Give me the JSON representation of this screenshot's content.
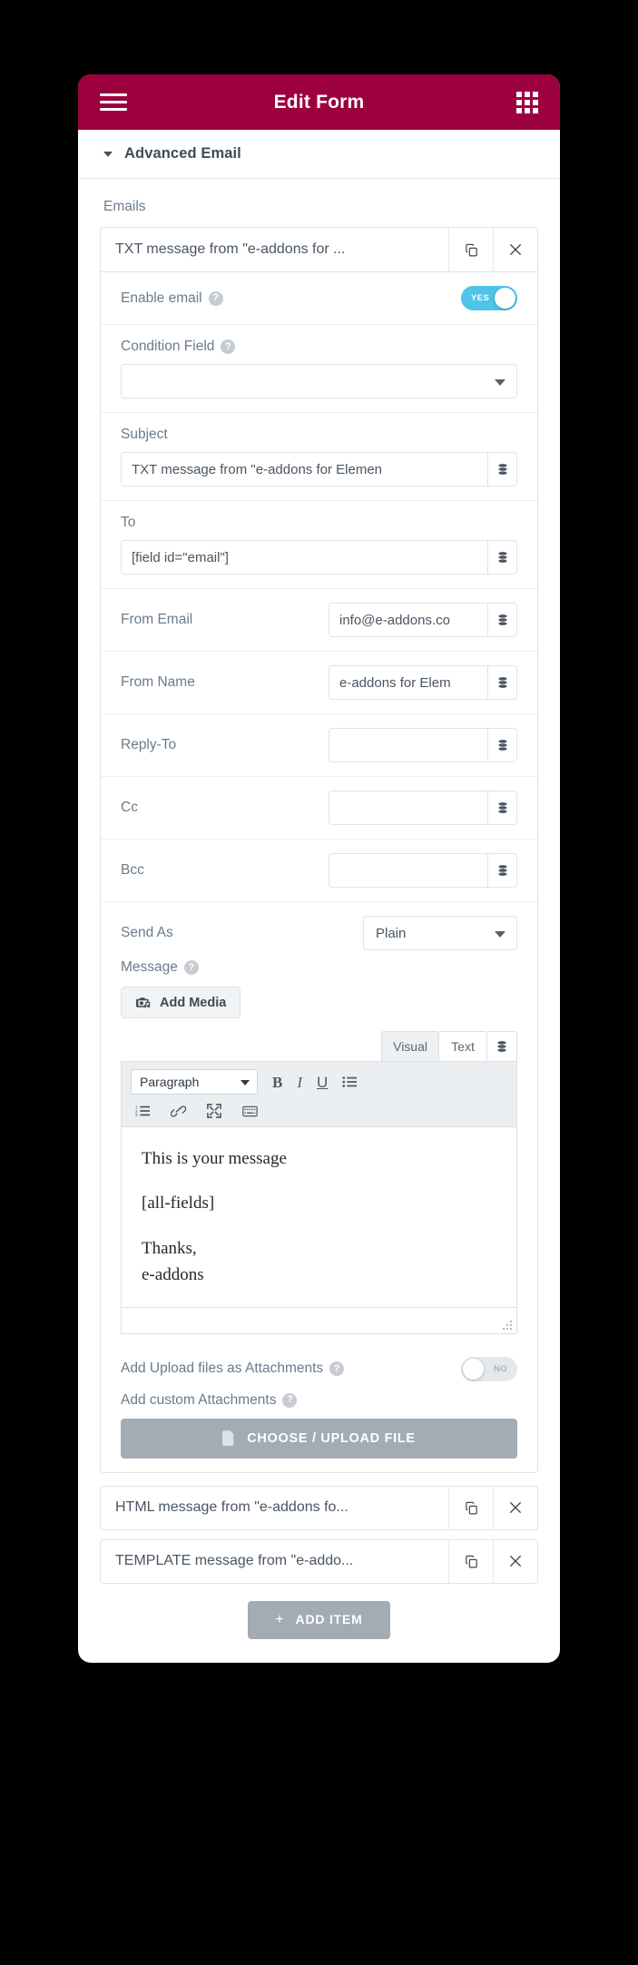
{
  "header": {
    "title": "Edit Form",
    "menu_icon": "hamburger-menu-icon",
    "apps_icon": "grid-apps-icon",
    "bg_color": "#9c003e"
  },
  "panel": {
    "title": "Advanced Email",
    "caret_icon": "caret-down-icon"
  },
  "emails_section": {
    "label": "Emails"
  },
  "open_item": {
    "title": "TXT message from \"e-addons for ...",
    "duplicate_icon": "copy-icon",
    "remove_icon": "close-x-icon",
    "enable_email": {
      "label": "Enable email",
      "help_icon": "question-mark-icon",
      "state": "on",
      "on_label": "YES",
      "off_label": "NO"
    },
    "condition_field": {
      "label": "Condition Field",
      "help_icon": "question-mark-icon",
      "value": "",
      "caret_icon": "chevron-down-icon"
    },
    "subject": {
      "label": "Subject",
      "value": "TXT message from \"e-addons for Elemen",
      "db_icon": "database-stack-icon"
    },
    "to": {
      "label": "To",
      "value": "[field id=\"email\"]",
      "db_icon": "database-stack-icon"
    },
    "from_email": {
      "label": "From Email",
      "value": "info@e-addons.co",
      "db_icon": "database-stack-icon"
    },
    "from_name": {
      "label": "From Name",
      "value": "e-addons for Elem",
      "db_icon": "database-stack-icon"
    },
    "reply_to": {
      "label": "Reply-To",
      "value": "",
      "db_icon": "database-stack-icon"
    },
    "cc": {
      "label": "Cc",
      "value": "",
      "db_icon": "database-stack-icon"
    },
    "bcc": {
      "label": "Bcc",
      "value": "",
      "db_icon": "database-stack-icon"
    },
    "send_as": {
      "label": "Send As",
      "value": "Plain",
      "caret_icon": "chevron-down-icon"
    },
    "message": {
      "label": "Message",
      "help_icon": "question-mark-icon",
      "add_media_label": "Add Media",
      "add_media_icon": "camera-media-icon",
      "tabs": [
        {
          "label": "Visual",
          "active": false
        },
        {
          "label": "Text",
          "active": true
        }
      ],
      "db_icon": "database-stack-icon",
      "toolbar": {
        "format_value": "Paragraph",
        "buttons_row1": [
          "bold-icon",
          "italic-icon",
          "underline-icon",
          "bulleted-list-icon"
        ],
        "buttons_row2": [
          "numbered-list-icon",
          "link-icon",
          "fullscreen-icon",
          "keyboard-shortcuts-icon"
        ]
      },
      "content": [
        "This is your message",
        "[all-fields]",
        "Thanks,"
      ],
      "content_last": "e-addons",
      "resize_grip_icon": "resize-grip-icon"
    },
    "upload_attachments": {
      "label": "Add Upload files as Attachments",
      "help_icon": "question-mark-icon",
      "state": "off",
      "off_label": "NO"
    },
    "custom_attachments": {
      "label": "Add custom Attachments",
      "help_icon": "question-mark-icon",
      "button_label": "CHOOSE / UPLOAD FILE",
      "button_icon": "document-file-icon"
    }
  },
  "other_items": [
    {
      "title": "HTML message from \"e-addons fo...",
      "duplicate_icon": "copy-icon",
      "remove_icon": "close-x-icon"
    },
    {
      "title": "TEMPLATE message from \"e-addo...",
      "duplicate_icon": "copy-icon",
      "remove_icon": "close-x-icon"
    }
  ],
  "add_item": {
    "label": "ADD ITEM",
    "plus": "+"
  }
}
